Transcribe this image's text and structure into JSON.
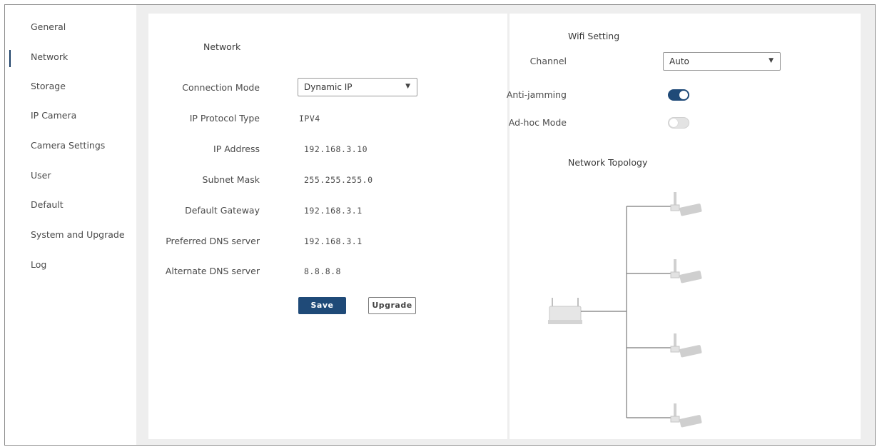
{
  "sidebar": {
    "items": [
      {
        "label": "General"
      },
      {
        "label": "Network"
      },
      {
        "label": "Storage"
      },
      {
        "label": "IP Camera"
      },
      {
        "label": "Camera Settings"
      },
      {
        "label": "User"
      },
      {
        "label": "Default"
      },
      {
        "label": "System and Upgrade"
      },
      {
        "label": "Log"
      }
    ],
    "active": "Network"
  },
  "network": {
    "title": "Network",
    "connection_mode": {
      "label": "Connection Mode",
      "value": "Dynamic IP"
    },
    "ip_protocol_type": {
      "label": "IP Protocol Type",
      "value": "IPV4"
    },
    "ip_address": {
      "label": "IP Address",
      "value": "192.168.3.10"
    },
    "subnet_mask": {
      "label": "Subnet Mask",
      "value": "255.255.255.0"
    },
    "default_gateway": {
      "label": "Default Gateway",
      "value": "192.168.3.1"
    },
    "preferred_dns": {
      "label": "Preferred DNS server",
      "value": "192.168.3.1"
    },
    "alternate_dns": {
      "label": "Alternate DNS server",
      "value": "8.8.8.8"
    },
    "save_label": "Save",
    "upgrade_label": "Upgrade"
  },
  "wifi": {
    "title": "Wifi Setting",
    "channel": {
      "label": "Channel",
      "value": "Auto"
    },
    "anti_jamming": {
      "label": "Anti-jamming",
      "enabled": true
    },
    "adhoc_mode": {
      "label": "Ad-hoc Mode",
      "enabled": false
    },
    "topology_title": "Network Topology"
  },
  "colors": {
    "accent": "#1f4a78",
    "background": "#eeeeee",
    "panel": "#ffffff"
  }
}
